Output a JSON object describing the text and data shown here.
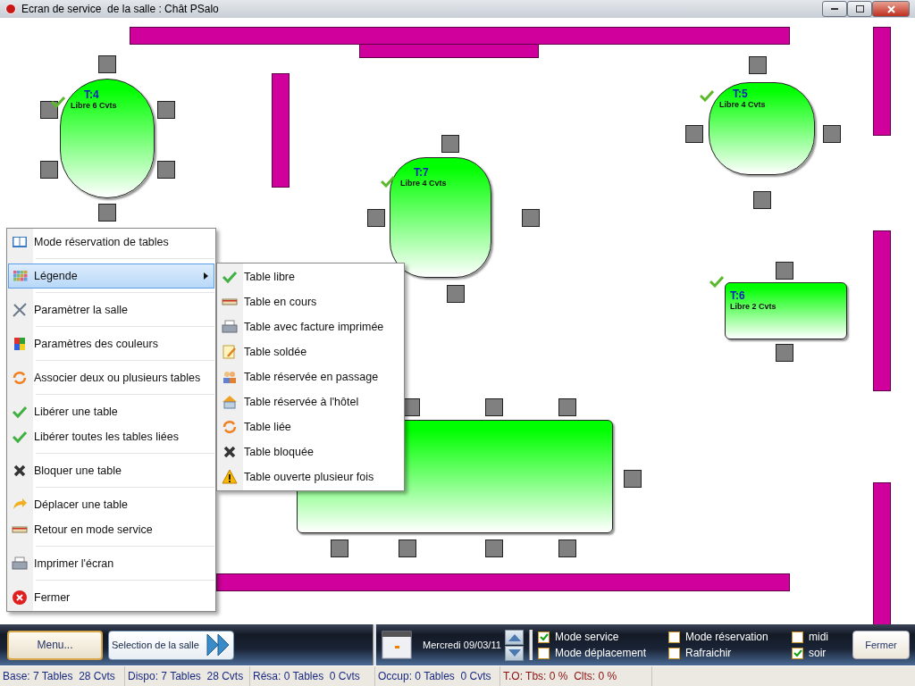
{
  "window": {
    "title": "Ecran de service  de la salle : Chât PSalo"
  },
  "tables": [
    {
      "label": "T:4",
      "status": "Libre 6 Cvts",
      "checked": true
    },
    {
      "label": "T:7",
      "status": "Libre 4 Cvts",
      "checked": true
    },
    {
      "label": "T:5",
      "status": "Libre 4 Cvts",
      "checked": true
    },
    {
      "label": "T:6",
      "status": "Libre 2 Cvts",
      "checked": true
    }
  ],
  "menu": {
    "groups": [
      [
        {
          "label": "Mode réservation de tables",
          "selected": false,
          "submenu": false
        }
      ],
      [
        {
          "label": "Légende",
          "selected": true,
          "submenu": true
        }
      ],
      [
        {
          "label": "Paramètrer la salle",
          "selected": false,
          "submenu": false
        }
      ],
      [
        {
          "label": "Paramètres des couleurs",
          "selected": false,
          "submenu": false
        }
      ],
      [
        {
          "label": "Associer deux ou plusieurs tables",
          "selected": false,
          "submenu": false
        }
      ],
      [
        {
          "label": "Libérer une table",
          "selected": false,
          "submenu": false
        },
        {
          "label": "Libérer toutes les tables liées",
          "selected": false,
          "submenu": false
        }
      ],
      [
        {
          "label": "Bloquer une table",
          "selected": false,
          "submenu": false
        }
      ],
      [
        {
          "label": "Déplacer une table",
          "selected": false,
          "submenu": false
        },
        {
          "label": "Retour en mode service",
          "selected": false,
          "submenu": false
        }
      ],
      [
        {
          "label": "Imprimer l'écran",
          "selected": false,
          "submenu": false
        }
      ],
      [
        {
          "label": "Fermer",
          "selected": false,
          "submenu": false
        }
      ]
    ]
  },
  "legend_submenu": [
    "Table libre",
    "Table en cours",
    "Table avec facture imprimée",
    "Table soldée",
    "Table réservée en passage",
    "Table réservée à l'hôtel",
    "Table liée",
    "Table bloquée",
    "Table ouverte plusieur fois"
  ],
  "toolbar": {
    "menu_button": "Menu...",
    "room_button": "Selection de la salle",
    "date": "Mercredi 09/03/11",
    "checkboxes": [
      {
        "label": "Mode service",
        "checked": true
      },
      {
        "label": "Mode déplacement",
        "checked": false
      },
      {
        "label": "Mode réservation",
        "checked": false
      },
      {
        "label": "Rafraichir",
        "checked": false
      },
      {
        "label": "midi",
        "checked": false
      },
      {
        "label": "soir",
        "checked": true
      }
    ],
    "close_button": "Fermer"
  },
  "status_bar": [
    {
      "text": "Base: 7 Tables  28 Cvts",
      "color": "#1a2a80"
    },
    {
      "text": "Dispo: 7 Tables  28 Cvts",
      "color": "#1a2a80"
    },
    {
      "text": "Résa: 0 Tables  0 Cvts",
      "color": "#1a2a80"
    },
    {
      "text": "Occup: 0 Tables  0 Cvts",
      "color": "#1a2a80"
    },
    {
      "text": "T.O: Tbs: 0 %  Clts: 0 %",
      "color": "#8a1010"
    }
  ]
}
